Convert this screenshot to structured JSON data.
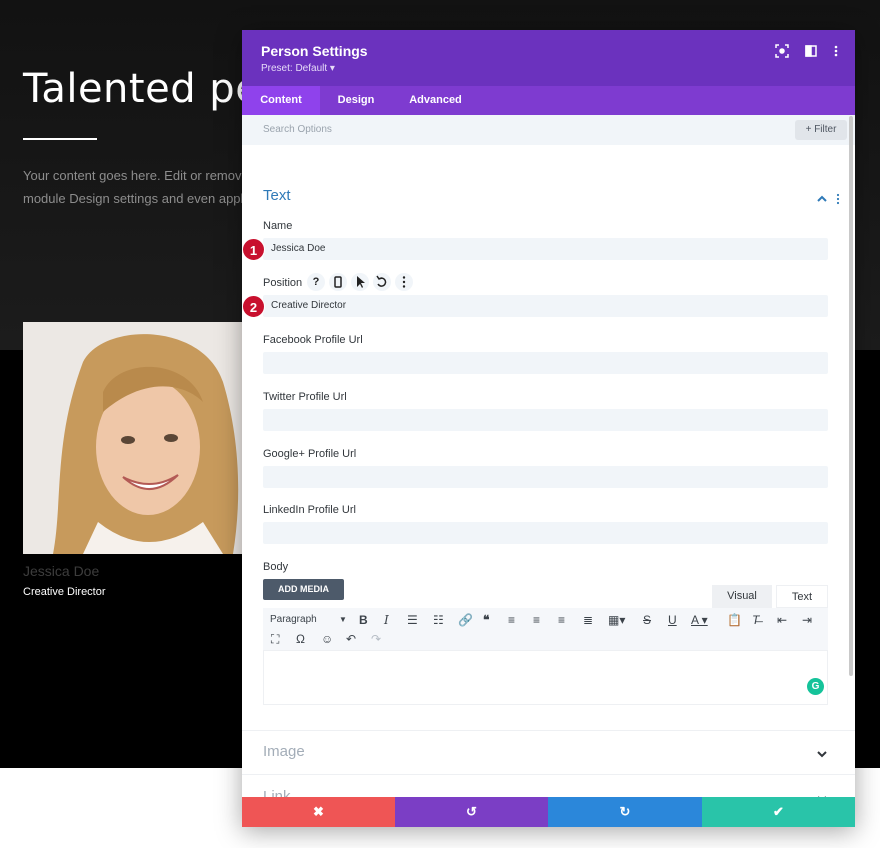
{
  "page": {
    "hero_title": "Talented peo",
    "hero_text": "Your content goes here. Edit or remove module Design settings and even appl",
    "person_name": "Jessica Doe",
    "person_position": "Creative Director"
  },
  "modal": {
    "title": "Person Settings",
    "preset": "Preset: Default ▾",
    "header_icons": [
      "focus-icon",
      "split-view-icon",
      "more-vertical-icon"
    ],
    "tabs": [
      {
        "label": "Content",
        "active": true
      },
      {
        "label": "Design",
        "active": false
      },
      {
        "label": "Advanced",
        "active": false
      }
    ],
    "search": {
      "placeholder": "Search Options",
      "filter_label": "+ Filter"
    },
    "sections": {
      "text": {
        "title": "Text",
        "fields": {
          "name": {
            "label": "Name",
            "value": "Jessica Doe"
          },
          "position": {
            "label": "Position",
            "value": "Creative Director"
          },
          "facebook": {
            "label": "Facebook Profile Url",
            "value": ""
          },
          "twitter": {
            "label": "Twitter Profile Url",
            "value": ""
          },
          "google": {
            "label": "Google+ Profile Url",
            "value": ""
          },
          "linkedin": {
            "label": "LinkedIn Profile Url",
            "value": ""
          },
          "body": {
            "label": "Body"
          }
        },
        "position_icons": [
          "help-icon",
          "mobile-icon",
          "cursor-icon",
          "undo-icon",
          "more-icon"
        ],
        "badges": [
          "1",
          "2"
        ],
        "editor": {
          "add_media": "ADD MEDIA",
          "tab_visual": "Visual",
          "tab_text": "Text",
          "format_select": "Paragraph",
          "grammarly": "G"
        }
      },
      "image": {
        "title": "Image"
      },
      "link": {
        "title": "Link"
      }
    },
    "footer": {
      "cancel": "✖",
      "undo": "↺",
      "redo": "↻",
      "save": "✔"
    }
  },
  "colors": {
    "header_purple": "#6b32be",
    "tab_purple": "#7e3bd0",
    "cancel_red": "#ef5555",
    "undo_purple": "#7b3ec5",
    "redo_blue": "#2b87da",
    "save_green": "#29c4a9",
    "badge_red": "#c8102e"
  }
}
